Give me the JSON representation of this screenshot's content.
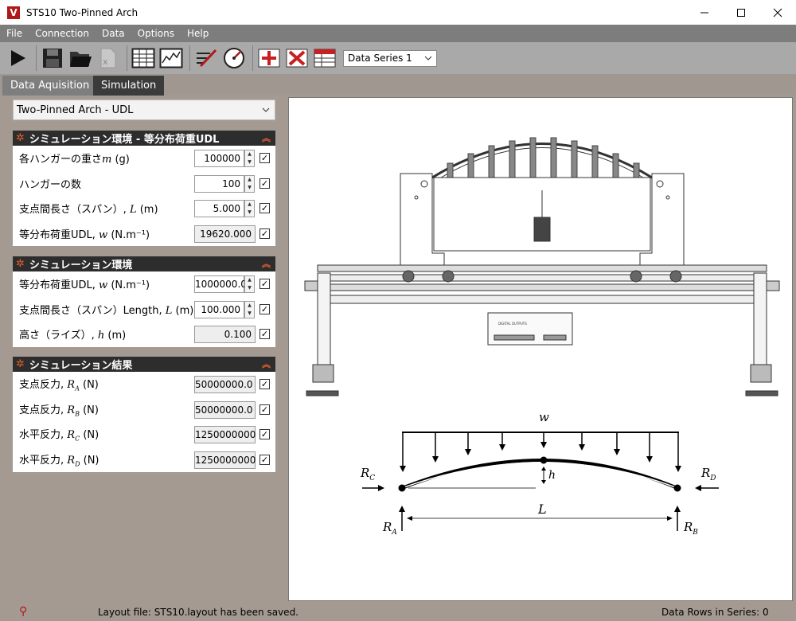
{
  "window": {
    "title": "STS10 Two-Pinned Arch",
    "app_icon": "V"
  },
  "menu": [
    "File",
    "Connection",
    "Data",
    "Options",
    "Help"
  ],
  "toolbar": {
    "series_select": "Data Series 1"
  },
  "tabs": [
    {
      "label": "Data Aquisition"
    },
    {
      "label": "Simulation"
    }
  ],
  "model_select": "Two-Pinned Arch - UDL",
  "sections": {
    "udl_env": {
      "title": "シミュレーション環境 - 等分布荷重UDL",
      "rows": [
        {
          "label": "各ハンガーの重さ",
          "sym": "m",
          "unit": "(g)",
          "value": "100000"
        },
        {
          "label": "ハンガーの数",
          "sym": "",
          "unit": "",
          "value": "100"
        },
        {
          "label": "支点間長さ（スパン）,",
          "sym": "L",
          "unit": "(m)",
          "value": "5.000"
        },
        {
          "label": "等分布荷重UDL,",
          "sym": "w",
          "unit": "(N.m⁻¹)",
          "value": "19620.000"
        }
      ]
    },
    "env": {
      "title": "シミュレーション環境",
      "rows": [
        {
          "label": "等分布荷重UDL,",
          "sym": "w",
          "unit": "(N.m⁻¹)",
          "value": "1000000.0"
        },
        {
          "label": "支点間長さ（スパン）Length,",
          "sym": "L",
          "unit": "(m)",
          "value": "100.000"
        },
        {
          "label": "高さ（ライズ）,",
          "sym": "h",
          "unit": "(m)",
          "value": "0.100"
        }
      ]
    },
    "results": {
      "title": "シミュレーション結果",
      "rows": [
        {
          "label": "支点反力,",
          "sym": "R",
          "sub": "A",
          "unit": "(N)",
          "value": "50000000.0"
        },
        {
          "label": "支点反力,",
          "sym": "R",
          "sub": "B",
          "unit": "(N)",
          "value": "50000000.0"
        },
        {
          "label": "水平反力,",
          "sym": "R",
          "sub": "C",
          "unit": "(N)",
          "value": "1250000000"
        },
        {
          "label": "水平反力,",
          "sym": "R",
          "sub": "D",
          "unit": "(N)",
          "value": "1250000000"
        }
      ]
    }
  },
  "diagram": {
    "w": "w",
    "h": "h",
    "L": "L",
    "RC": "R",
    "RC_sub": "C",
    "RD": "R",
    "RD_sub": "D",
    "RA": "R",
    "RA_sub": "A",
    "RB": "R",
    "RB_sub": "B",
    "panel_label": "DIGITAL OUTPUTS"
  },
  "status": {
    "message": "Layout file: STS10.layout has been saved.",
    "rows": "Data Rows in Series: 0"
  },
  "colors": {
    "accent": "#e8602c",
    "brand": "#b01818",
    "header_bg": "#2d2d2d",
    "panel_bg": "#a59a92"
  }
}
